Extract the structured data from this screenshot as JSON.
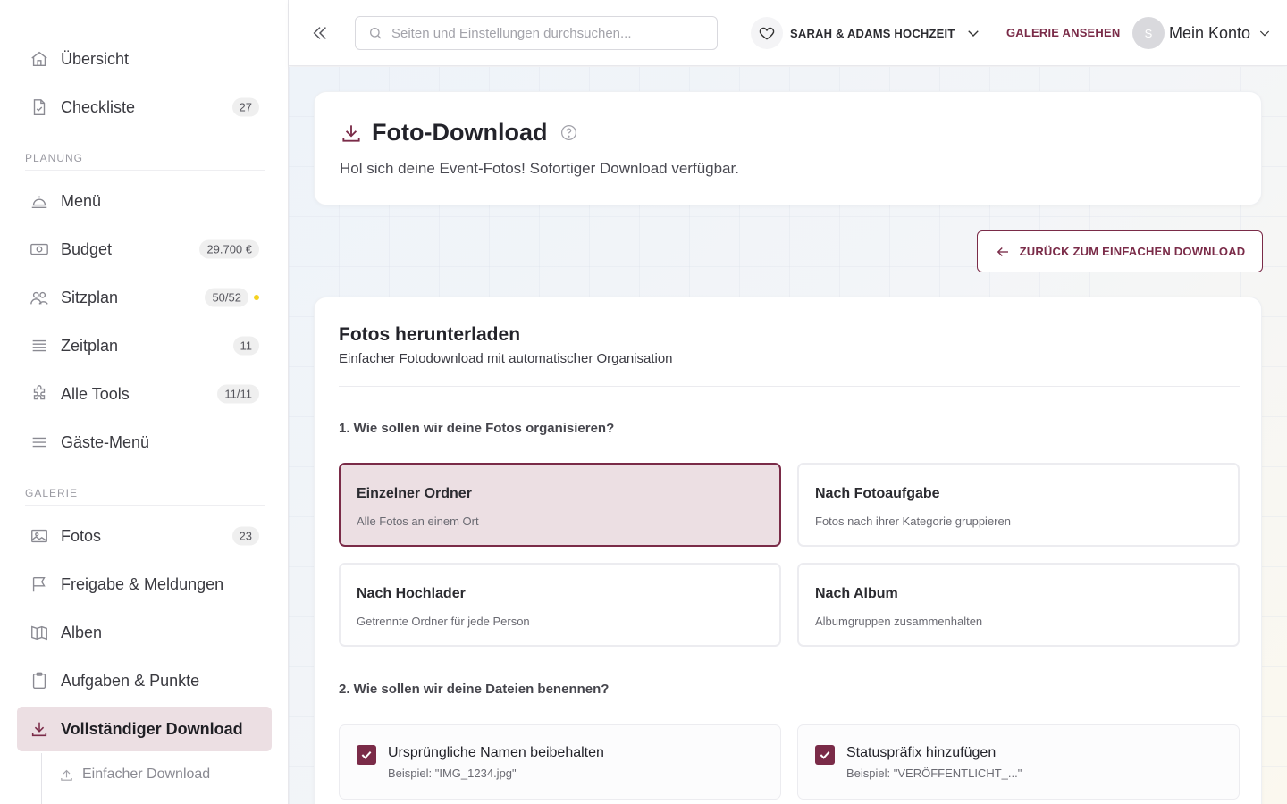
{
  "sidebar": {
    "items": [
      {
        "label": "Übersicht",
        "icon": "home-icon"
      },
      {
        "label": "Checkliste",
        "icon": "checklist-icon",
        "badge": "27"
      },
      {
        "label": "Menü",
        "icon": "cloche-icon"
      },
      {
        "label": "Budget",
        "icon": "money-icon",
        "badge": "29.700 €"
      },
      {
        "label": "Sitzplan",
        "icon": "people-icon",
        "badge": "50/52"
      },
      {
        "label": "Zeitplan",
        "icon": "list-icon",
        "badge": "11"
      },
      {
        "label": "Alle Tools",
        "icon": "puzzle-icon",
        "badge": "11/11"
      },
      {
        "label": "Gäste-Menü",
        "icon": "menu-icon"
      },
      {
        "label": "Fotos",
        "icon": "image-icon",
        "badge": "23"
      },
      {
        "label": "Freigabe & Meldungen",
        "icon": "flag-icon"
      },
      {
        "label": "Alben",
        "icon": "book-icon"
      },
      {
        "label": "Aufgaben & Punkte",
        "icon": "clipboard-icon"
      },
      {
        "label": "Vollständiger Download",
        "icon": "download-icon"
      }
    ],
    "sections": {
      "planung": "PLANUNG",
      "galerie": "GALERIE"
    },
    "sub_item": {
      "label": "Einfacher Download",
      "icon": "upload-icon"
    }
  },
  "header": {
    "search_placeholder": "Seiten und Einstellungen durchsuchen...",
    "event_name": "SARAH & ADAMS HOCHZEIT",
    "gallery_link": "GALERIE ANSEHEN",
    "avatar_initial": "S",
    "account_label": "Mein Konto"
  },
  "page": {
    "title": "Foto-Download",
    "subtitle": "Hol sich deine Event-Fotos! Sofortiger Download verfügbar.",
    "back_button": "ZURÜCK ZUM EINFACHEN DOWNLOAD"
  },
  "download": {
    "title": "Fotos herunterladen",
    "subtitle": "Einfacher Fotodownload mit automatischer Organisation",
    "q1": "1. Wie sollen wir deine Fotos organisieren?",
    "options": [
      {
        "title": "Einzelner Ordner",
        "sub": "Alle Fotos an einem Ort",
        "selected": true
      },
      {
        "title": "Nach Fotoaufgabe",
        "sub": "Fotos nach ihrer Kategorie gruppieren",
        "selected": false
      },
      {
        "title": "Nach Hochlader",
        "sub": "Getrennte Ordner für jede Person",
        "selected": false
      },
      {
        "title": "Nach Album",
        "sub": "Albumgruppen zusammenhalten",
        "selected": false
      }
    ],
    "q2": "2. Wie sollen wir deine Dateien benennen?",
    "checks": [
      {
        "title": "Ursprüngliche Namen beibehalten",
        "sub": "Beispiel: \"IMG_1234.jpg\"",
        "checked": true
      },
      {
        "title": "Statuspräfix hinzufügen",
        "sub": "Beispiel: \"VERÖFFENTLICHT_...\"",
        "checked": true
      }
    ]
  },
  "colors": {
    "accent": "#7a2b48",
    "accent_bg": "#ecdfe3",
    "dot": "#f5d21f"
  }
}
